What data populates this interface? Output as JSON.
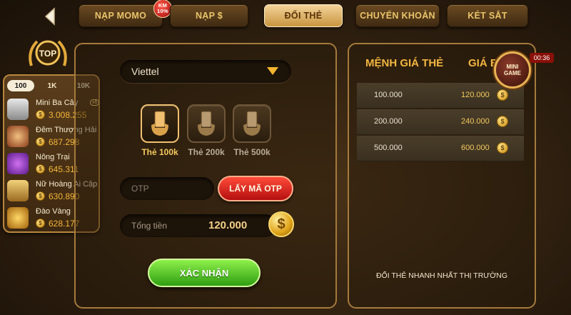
{
  "tabs": [
    {
      "label": "NẠP MOMO",
      "badge": "KM 10%"
    },
    {
      "label": "NẠP $"
    },
    {
      "label": "ĐỔI THẺ",
      "active": true
    },
    {
      "label": "CHUYỂN KHOẢN"
    },
    {
      "label": "KÉT SẮT"
    }
  ],
  "top_badge": "TOP",
  "leaderboard": {
    "filters": [
      "100",
      "1K",
      "10K"
    ],
    "active_filter": "100",
    "items": [
      {
        "name": "Mini Ba Cây",
        "amount": "3.008.255",
        "tag": "x6"
      },
      {
        "name": "Đêm Thượng Hải",
        "amount": "687.298"
      },
      {
        "name": "Nông Trại",
        "amount": "645.311"
      },
      {
        "name": "Nữ Hoàng Ai Cập",
        "amount": "630.890"
      },
      {
        "name": "Đào Vàng",
        "amount": "628.177"
      }
    ]
  },
  "form": {
    "carrier": "Viettel",
    "cards": [
      {
        "label": "Thẻ 100k",
        "active": true
      },
      {
        "label": "Thẻ 200k"
      },
      {
        "label": "Thẻ 500k"
      }
    ],
    "otp_placeholder": "OTP",
    "otp_button": "LẤY MÃ OTP",
    "total_label": "Tổng tiền",
    "total_value": "120.000",
    "confirm_button": "XÁC NHẬN"
  },
  "rates": {
    "header_face": "MỆNH GIÁ THẺ",
    "header_price": "GIÁ BÁ",
    "rows": [
      {
        "face": "100.000",
        "price": "120.000"
      },
      {
        "face": "200.000",
        "price": "240.000"
      },
      {
        "face": "500.000",
        "price": "600.000"
      }
    ],
    "footer": "ĐỔI THẺ NHANH NHẤT THỊ TRƯỜNG"
  },
  "mini_game": {
    "line1": "MINI",
    "line2": "GAME"
  },
  "timer": "00:36",
  "coin_symbol": "$",
  "colors": {
    "accent": "#f3b640",
    "active_tab": "#e8bb6a",
    "confirm": "#4cc01f",
    "otp": "#d41a14"
  }
}
